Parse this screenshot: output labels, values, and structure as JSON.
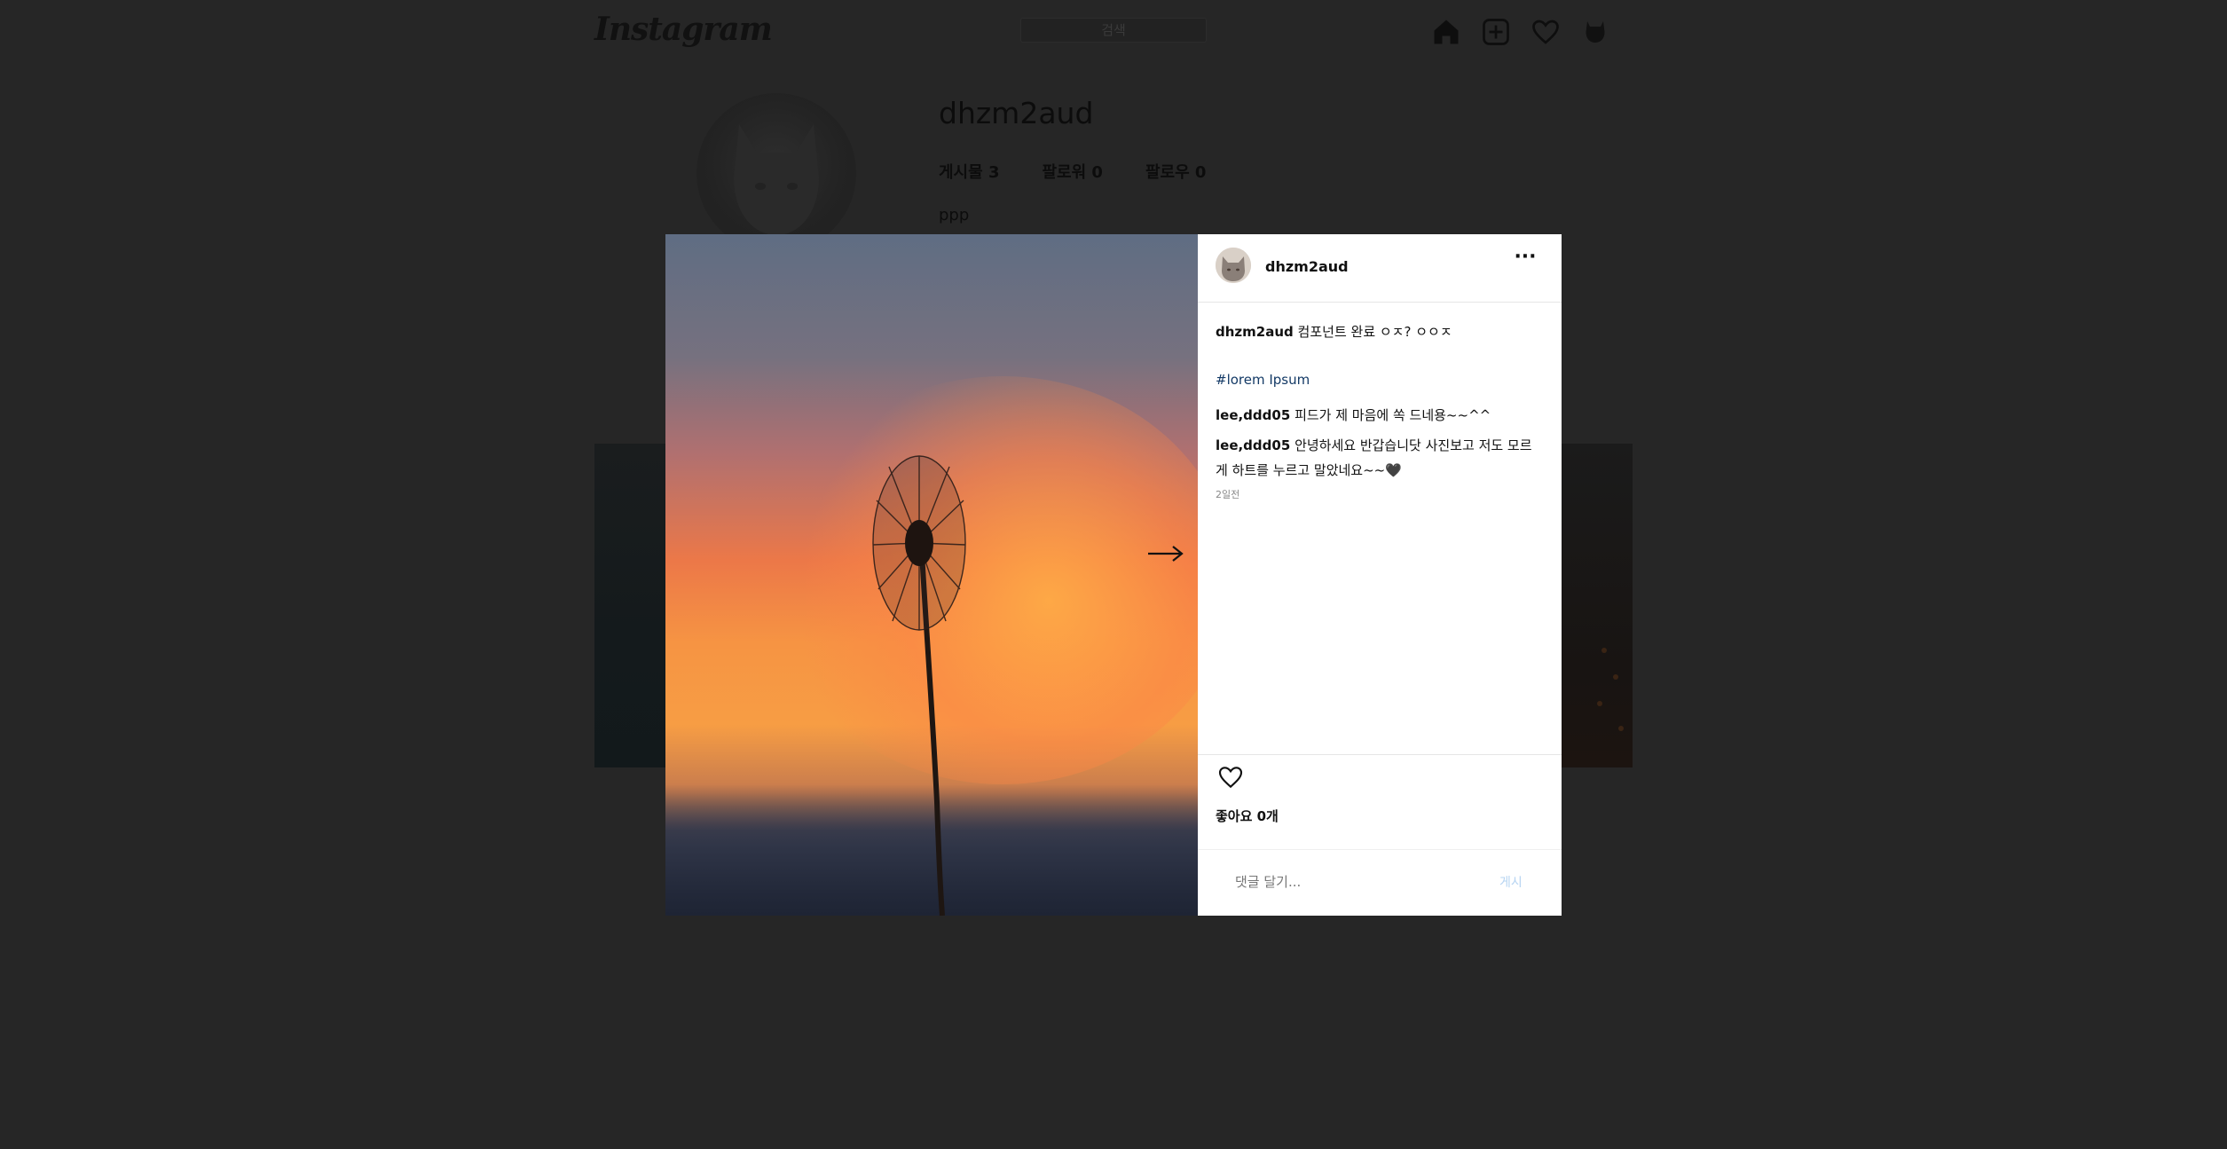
{
  "header": {
    "logo": "Instagram",
    "search_placeholder": "검색",
    "icons": [
      "home-icon",
      "add-post-icon",
      "heart-icon",
      "profile-icon"
    ]
  },
  "profile": {
    "username": "dhzm2aud",
    "posts_label": "게시물 3",
    "followers_label": "팔로워 0",
    "following_label": "팔로우 0",
    "bio": "ppp"
  },
  "modal": {
    "author": "dhzm2aud",
    "more_label": "···",
    "caption_user": "dhzm2aud",
    "caption_text": "컴포넌트 완료 ㅇㅈ? ㅇㅇㅈ",
    "hashtag": "#lorem Ipsum",
    "comments": [
      {
        "user": "lee,ddd05",
        "text": "피드가 제 마음에 쏙 드네용~~^^"
      },
      {
        "user": "lee,ddd05",
        "text": "안녕하세요 반갑습니닷 사진보고 저도 모르게 하트를 누르고 말았네요~~🖤"
      }
    ],
    "time": "2일전",
    "likes_label": "좋아요 0개",
    "comment_placeholder": "댓글 달기...",
    "post_button": "게시"
  },
  "colors": {
    "backdrop": "#262626",
    "modal_bg": "#ffffff",
    "hashtag": "#143a66",
    "post_button": "#b6d4f2"
  }
}
